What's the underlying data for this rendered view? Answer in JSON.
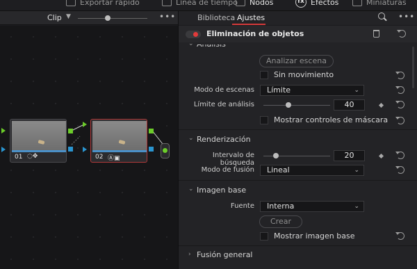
{
  "toolbar": {
    "items": [
      {
        "label": "Exportar rápido"
      },
      {
        "label": "Línea de tiempo"
      },
      {
        "label": "Nodos"
      },
      {
        "label": "Efectos"
      },
      {
        "label": "Miniaturas"
      }
    ]
  },
  "node_editor": {
    "mode_label": "Clip",
    "more_label": "•••",
    "nodes": [
      {
        "number": "01",
        "icons": "◌✥"
      },
      {
        "number": "02",
        "icons": "Ⓐ▣"
      }
    ]
  },
  "inspector": {
    "tabs": [
      "Biblioteca",
      "Ajustes"
    ],
    "active_tab": "Ajustes",
    "more_label": "•••",
    "effect_title": "Eliminación de objetos",
    "effect_enabled": true,
    "analysis": {
      "title": "Análisis",
      "analyze_button": "Analizar escena",
      "no_motion_label": "Sin movimiento",
      "no_motion_checked": false,
      "scene_mode_label": "Modo de escenas",
      "scene_mode_value": "Límite",
      "analysis_limit_label": "Límite de análisis",
      "analysis_limit_value": "40",
      "mask_controls_label": "Mostrar controles de máscara",
      "mask_controls_checked": false
    },
    "render": {
      "title": "Renderización",
      "search_interval_label": "Intervalo de búsqueda",
      "search_interval_value": "20",
      "blend_mode_label": "Modo de fusión",
      "blend_mode_value": "Lineal"
    },
    "base_image": {
      "title": "Imagen base",
      "source_label": "Fuente",
      "source_value": "Interna",
      "create_button": "Crear",
      "show_base_label": "Mostrar imagen base",
      "show_base_checked": false
    },
    "general_blend": {
      "title": "Fusión general"
    }
  },
  "colors": {
    "accent_red": "#d63a3a",
    "node_port_green": "#6ccd2a",
    "node_port_blue": "#2a95d0"
  }
}
